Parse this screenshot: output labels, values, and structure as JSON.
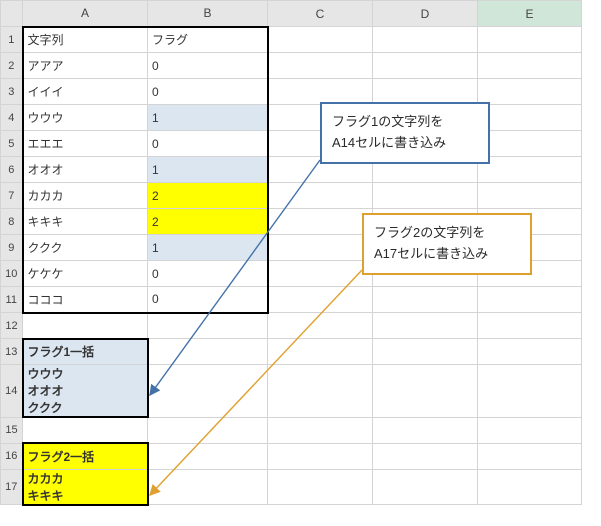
{
  "chart_data": {
    "type": "table",
    "title": "",
    "columns": [
      "文字列",
      "フラグ"
    ],
    "rows": [
      [
        "アアア",
        0
      ],
      [
        "イイイ",
        0
      ],
      [
        "ウウウ",
        1
      ],
      [
        "エエエ",
        0
      ],
      [
        "オオオ",
        1
      ],
      [
        "カカカ",
        2
      ],
      [
        "キキキ",
        2
      ],
      [
        "ククク",
        1
      ],
      [
        "ケケケ",
        0
      ],
      [
        "コココ",
        0
      ]
    ]
  },
  "headers": {
    "A": "A",
    "B": "B",
    "C": "C",
    "D": "D",
    "E": "E"
  },
  "rownums": [
    "1",
    "2",
    "3",
    "4",
    "5",
    "6",
    "7",
    "8",
    "9",
    "10",
    "11",
    "12",
    "13",
    "14",
    "15",
    "16",
    "17"
  ],
  "col_label": {
    "A": "文字列",
    "B": "フラグ"
  },
  "cells": {
    "A2": "アアア",
    "B2": "0",
    "A3": "イイイ",
    "B3": "0",
    "A4": "ウウウ",
    "B4": "1",
    "A5": "エエエ",
    "B5": "0",
    "A6": "オオオ",
    "B6": "1",
    "A7": "カカカ",
    "B7": "2",
    "A8": "キキキ",
    "B8": "2",
    "A9": "ククク",
    "B9": "1",
    "A10": "ケケケ",
    "B10": "0",
    "A11": "コココ",
    "B11": "0"
  },
  "block1": {
    "title": "フラグ1一括",
    "l1": "ウウウ",
    "l2": "オオオ",
    "l3": "ククク"
  },
  "block2": {
    "title": "フラグ2一括",
    "l1": "カカカ",
    "l2": "キキキ"
  },
  "callout1": {
    "line1": "フラグ1の文字列を",
    "line2": "A14セルに書き込み"
  },
  "callout2": {
    "line1": "フラグ2の文字列を",
    "line2": "A17セルに書き込み"
  }
}
